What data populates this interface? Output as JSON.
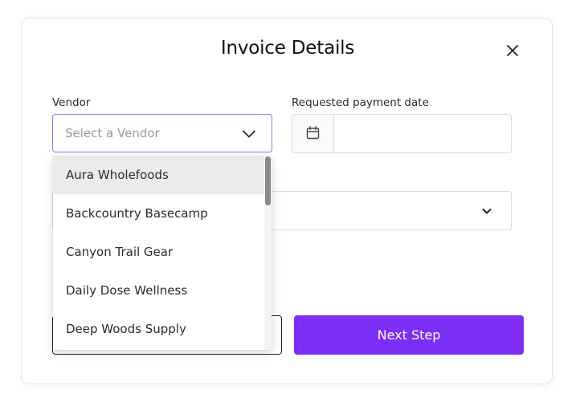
{
  "modal": {
    "title": "Invoice Details",
    "close_icon": "close-icon"
  },
  "vendor": {
    "label": "Vendor",
    "placeholder": "Select a Vendor",
    "chevron_icon": "chevron-down-icon",
    "options": [
      "Aura Wholefoods",
      "Backcountry Basecamp",
      "Canyon Trail Gear",
      "Daily Dose Wellness",
      "Deep Woods Supply"
    ],
    "highlighted_index": 0
  },
  "payment_date": {
    "label": "Requested payment date",
    "value": "",
    "calendar_icon": "calendar-icon"
  },
  "second_select": {
    "value": "",
    "chevron_icon": "chevron-down-icon"
  },
  "actions": {
    "back_label": "",
    "next_label": "Next Step"
  },
  "colors": {
    "accent": "#7c2ef5",
    "focus_border": "#a06ef8",
    "highlight_bg": "#ebebeb"
  }
}
